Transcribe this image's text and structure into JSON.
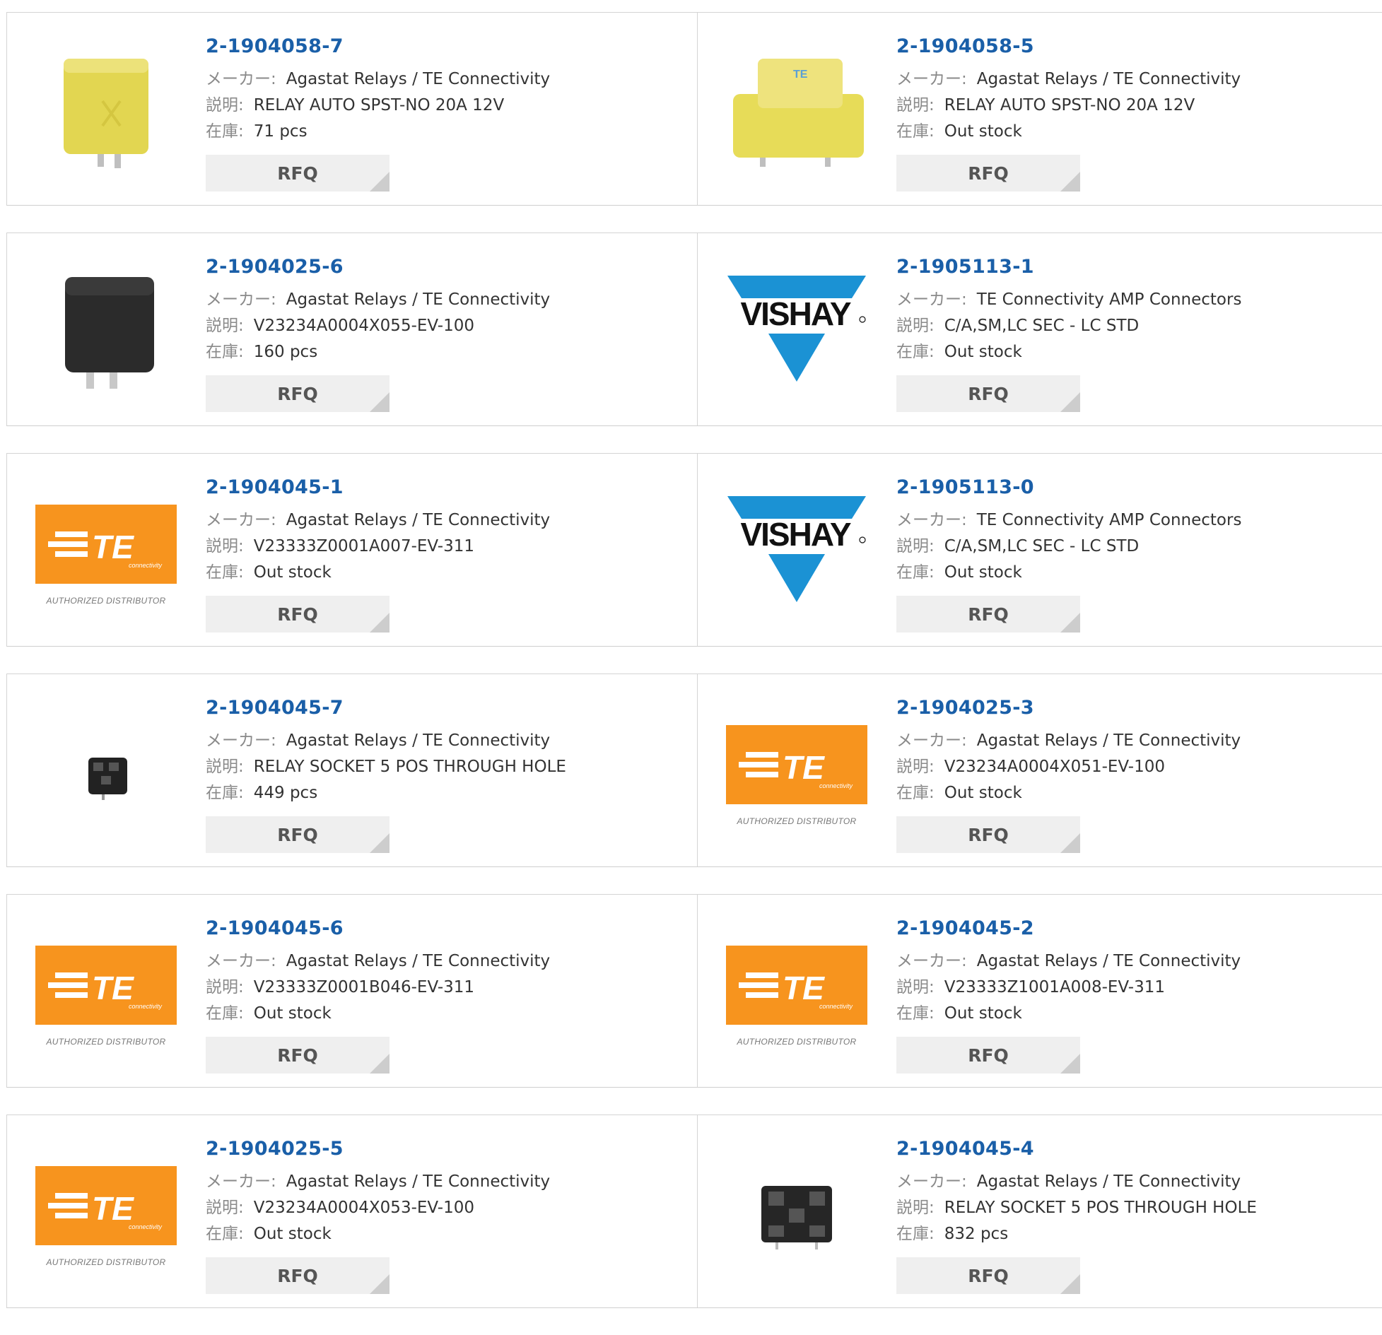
{
  "labels": {
    "maker": "メーカー:",
    "desc": "説明:",
    "stock": "在庫:",
    "rfq": "RFQ"
  },
  "colors": {
    "part_link": "#1a5fa8",
    "te_orange": "#f7941e",
    "vishay_blue": "#1b92d4",
    "relay_yellow": "#e9e05a"
  },
  "logo_text": {
    "vishay": "VISHAY",
    "te": "TE",
    "te_sub": "connectivity",
    "te_authorized": "AUTHORIZED DISTRIBUTOR"
  },
  "products": [
    {
      "part": "2-1904058-7",
      "maker": "Agastat Relays / TE Connectivity",
      "desc": "RELAY AUTO SPST-NO 20A 12V",
      "stock": "71 pcs",
      "image": "yellow-relay-icon"
    },
    {
      "part": "2-1904058-5",
      "maker": "Agastat Relays / TE Connectivity",
      "desc": "RELAY AUTO SPST-NO 20A 12V",
      "stock": "Out stock",
      "image": "yellow-flat-relay-icon"
    },
    {
      "part": "2-1904025-6",
      "maker": "Agastat Relays / TE Connectivity",
      "desc": "V23234A0004X055-EV-100",
      "stock": "160 pcs",
      "image": "black-relay-icon"
    },
    {
      "part": "2-1905113-1",
      "maker": "TE Connectivity AMP Connectors",
      "desc": "C/A,SM,LC SEC - LC STD",
      "stock": "Out stock",
      "image": "vishay-logo"
    },
    {
      "part": "2-1904045-1",
      "maker": "Agastat Relays / TE Connectivity",
      "desc": "V23333Z0001A007-EV-311",
      "stock": "Out stock",
      "image": "te-logo"
    },
    {
      "part": "2-1905113-0",
      "maker": "TE Connectivity AMP Connectors",
      "desc": "C/A,SM,LC SEC - LC STD",
      "stock": "Out stock",
      "image": "vishay-logo"
    },
    {
      "part": "2-1904045-7",
      "maker": "Agastat Relays / TE Connectivity",
      "desc": "RELAY SOCKET 5 POS THROUGH HOLE",
      "stock": "449 pcs",
      "image": "small-socket-icon"
    },
    {
      "part": "2-1904025-3",
      "maker": "Agastat Relays / TE Connectivity",
      "desc": "V23234A0004X051-EV-100",
      "stock": "Out stock",
      "image": "te-logo"
    },
    {
      "part": "2-1904045-6",
      "maker": "Agastat Relays / TE Connectivity",
      "desc": "V23333Z0001B046-EV-311",
      "stock": "Out stock",
      "image": "te-logo"
    },
    {
      "part": "2-1904045-2",
      "maker": "Agastat Relays / TE Connectivity",
      "desc": "V23333Z1001A008-EV-311",
      "stock": "Out stock",
      "image": "te-logo"
    },
    {
      "part": "2-1904025-5",
      "maker": "Agastat Relays / TE Connectivity",
      "desc": "V23234A0004X053-EV-100",
      "stock": "Out stock",
      "image": "te-logo"
    },
    {
      "part": "2-1904045-4",
      "maker": "Agastat Relays / TE Connectivity",
      "desc": "RELAY SOCKET 5 POS THROUGH HOLE",
      "stock": "832 pcs",
      "image": "black-socket-icon"
    }
  ]
}
